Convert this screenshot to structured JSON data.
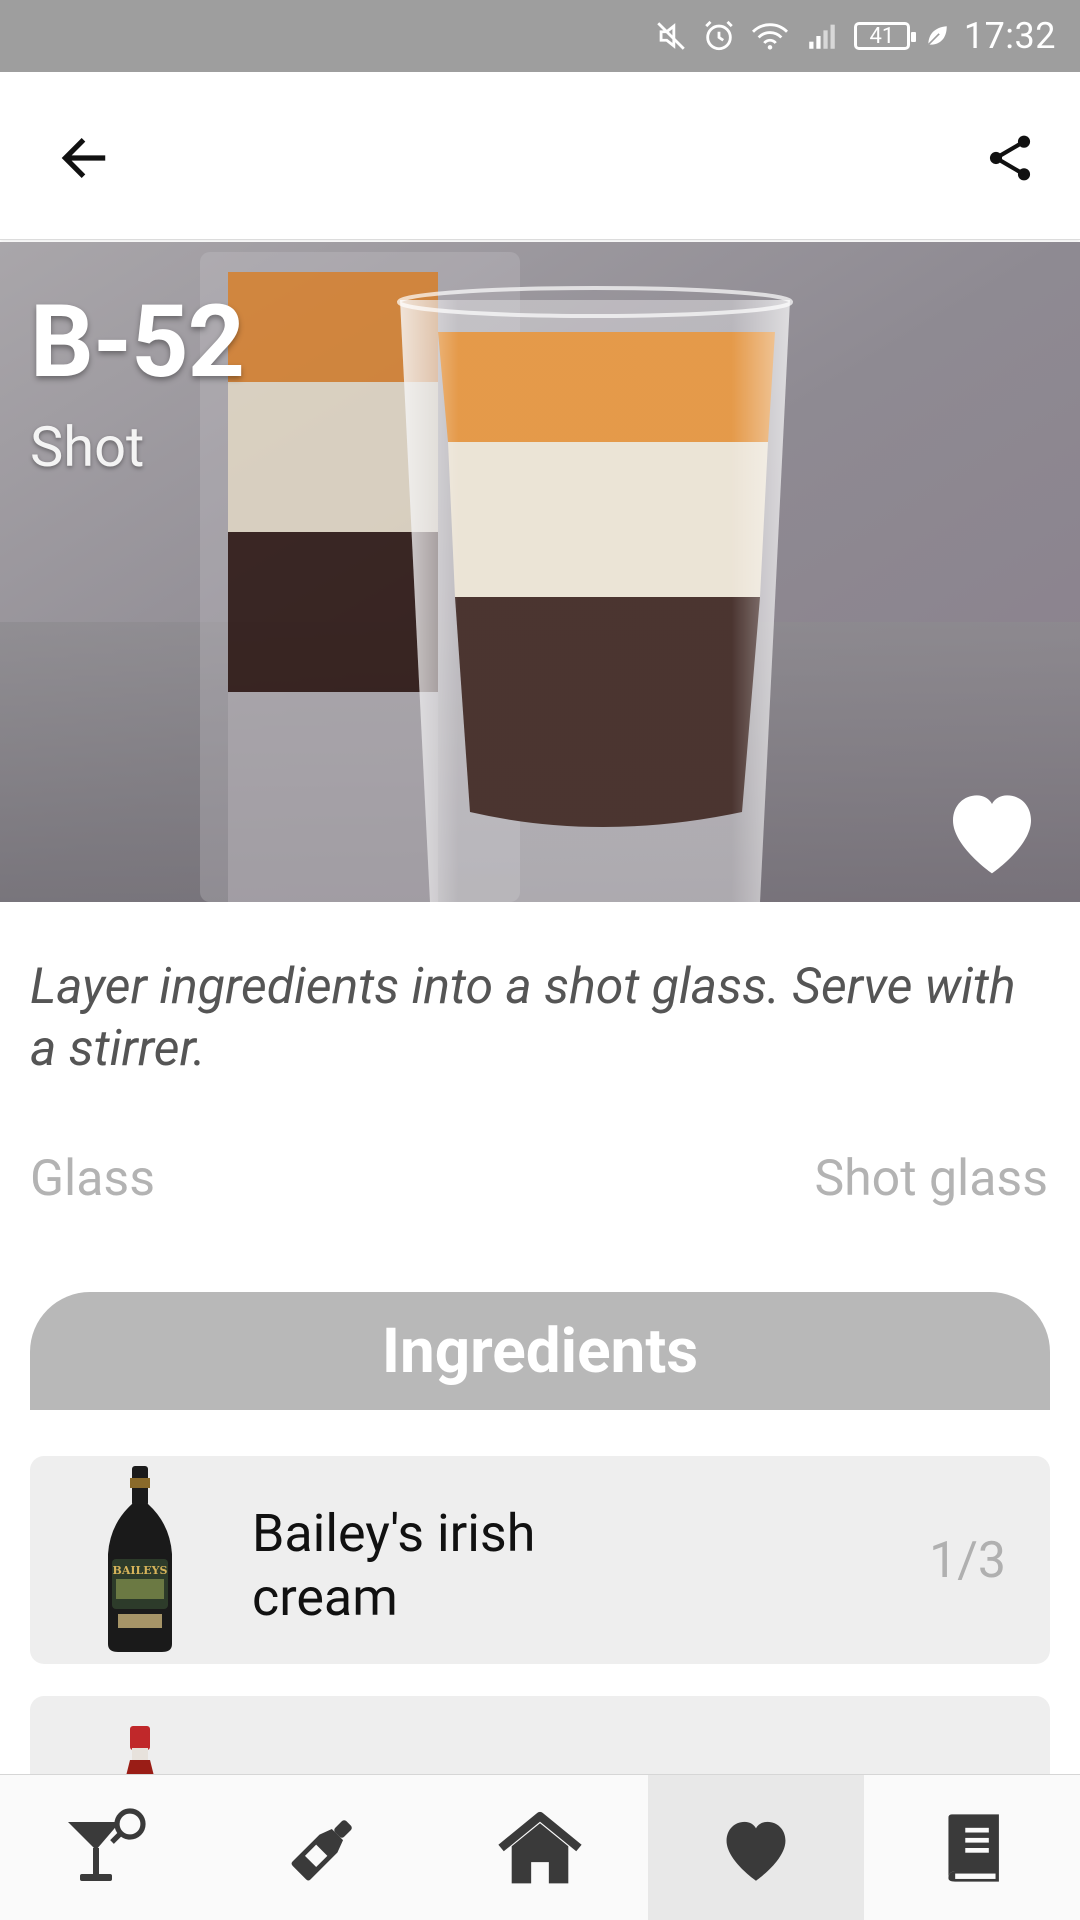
{
  "status_bar": {
    "time": "17:32",
    "battery": "41",
    "icons": [
      "mute-icon",
      "alarm-icon",
      "wifi-icon",
      "signal-icon",
      "battery-icon",
      "leaf-icon"
    ]
  },
  "app_bar": {
    "back_icon": "arrow-back-icon",
    "share_icon": "share-icon"
  },
  "hero": {
    "title": "B-52",
    "subtitle": "Shot",
    "favorite_icon": "heart-icon"
  },
  "instructions": "Layer ingredients into a shot glass. Serve with a stirrer.",
  "glass": {
    "label": "Glass",
    "value": "Shot glass"
  },
  "ingredients": {
    "header": "Ingredients",
    "items": [
      {
        "name": "Bailey's irish cream",
        "amount": "1/3",
        "image": "baileys-bottle"
      },
      {
        "name": "",
        "amount": "",
        "image": "red-liqueur-bottle"
      }
    ]
  },
  "bottom_nav": {
    "active_index": 3,
    "items": [
      {
        "icon": "cocktail-search-icon"
      },
      {
        "icon": "bottle-icon"
      },
      {
        "icon": "home-icon"
      },
      {
        "icon": "heart-icon"
      },
      {
        "icon": "book-icon"
      }
    ]
  },
  "colors": {
    "status_bar": "#9e9e9e",
    "section_header": "#b8b8b8",
    "card_background": "#eeeeee",
    "muted_text": "#b3b3b3",
    "icon_dark": "#3a3a3a"
  }
}
